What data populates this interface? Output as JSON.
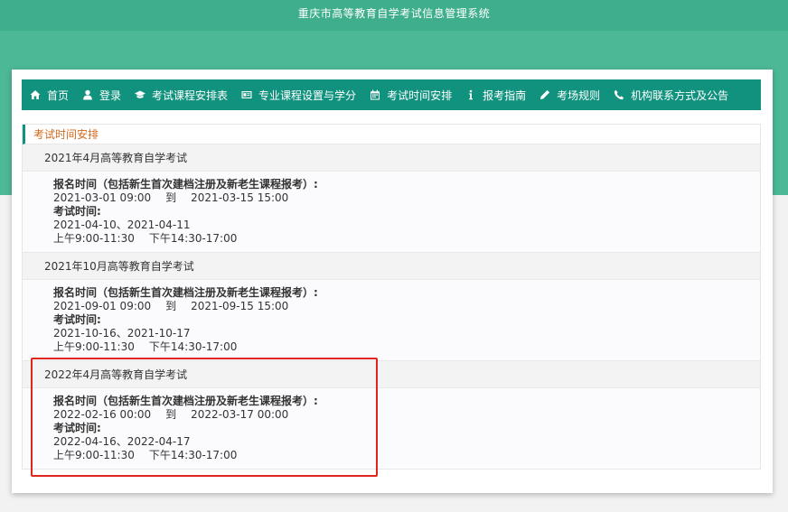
{
  "site": {
    "title": "重庆市高等教育自学考试信息管理系统"
  },
  "nav": [
    {
      "icon": "home-icon",
      "label": "首页"
    },
    {
      "icon": "user-icon",
      "label": "登录"
    },
    {
      "icon": "graduation-cap-icon",
      "label": "考试课程安排表"
    },
    {
      "icon": "id-card-icon",
      "label": "专业课程设置与学分"
    },
    {
      "icon": "calendar-icon",
      "label": "考试时间安排"
    },
    {
      "icon": "info-icon",
      "label": "报考指南"
    },
    {
      "icon": "pencil-icon",
      "label": "考场规则"
    },
    {
      "icon": "phone-icon",
      "label": "机构联系方式及公告"
    }
  ],
  "section": {
    "title": "考试时间安排"
  },
  "exams": [
    {
      "name": "2021年4月高等教育自学考试",
      "reg_label": "报名时间（包括新生首次建档注册及新老生课程报考）:",
      "reg_start": "2021-03-01 09:00",
      "to": "到",
      "reg_end": "2021-03-15 15:00",
      "exam_label": "考试时间:",
      "exam_dates": "2021-04-10、2021-04-11",
      "am": "上午9:00-11:30",
      "pm": "下午14:30-17:00"
    },
    {
      "name": "2021年10月高等教育自学考试",
      "reg_label": "报名时间（包括新生首次建档注册及新老生课程报考）:",
      "reg_start": "2021-09-01 09:00",
      "to": "到",
      "reg_end": "2021-09-15 15:00",
      "exam_label": "考试时间:",
      "exam_dates": "2021-10-16、2021-10-17",
      "am": "上午9:00-11:30",
      "pm": "下午14:30-17:00"
    },
    {
      "name": "2022年4月高等教育自学考试",
      "reg_label": "报名时间（包括新生首次建档注册及新老生课程报考）:",
      "reg_start": "2022-02-16 00:00",
      "to": "到",
      "reg_end": "2022-03-17 00:00",
      "exam_label": "考试时间:",
      "exam_dates": "2022-04-16、2022-04-17",
      "am": "上午9:00-11:30",
      "pm": "下午14:30-17:00"
    }
  ],
  "colors": {
    "brand": "#11927e",
    "header": "#4db896",
    "accent": "#d2691e",
    "highlight": "#e0251f"
  }
}
